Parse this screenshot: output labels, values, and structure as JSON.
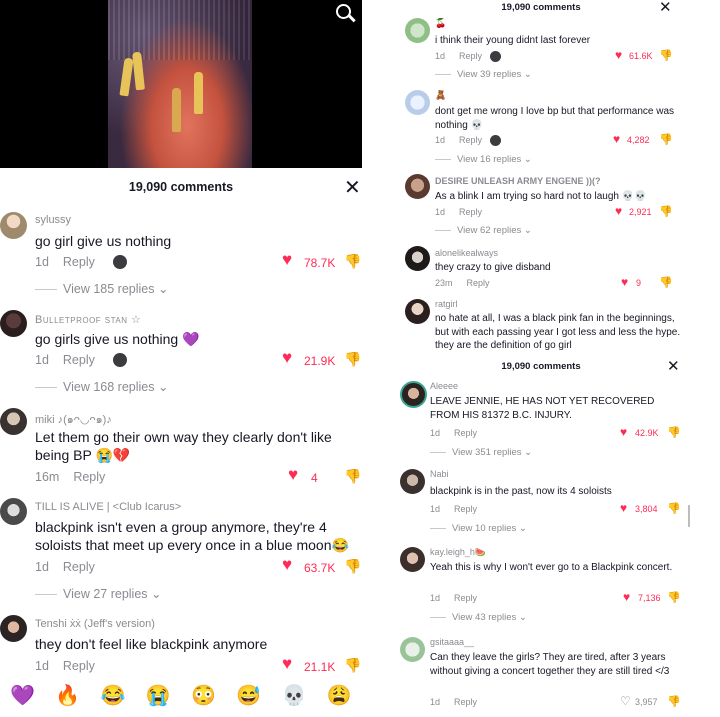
{
  "left": {
    "header": {
      "count": "19,090 comments"
    },
    "comments": [
      {
        "user": "sylussy",
        "text": "go girl give us nothing",
        "age": "1d",
        "reply": "Reply",
        "likes": "78.7K",
        "liked": true,
        "view": "View 185 replies"
      },
      {
        "user": "Bulletproof stan ☆",
        "text": "go girls give us nothing 💜",
        "age": "1d",
        "reply": "Reply",
        "likes": "21.9K",
        "liked": true,
        "view": "View 168 replies"
      },
      {
        "user": "miki ♪(๑ᴖ◡ᴖ๑)♪",
        "text": "Let them go their own way they clearly don't like being BP 😭💔",
        "age": "16m",
        "reply": "Reply",
        "likes": "4",
        "liked": true
      },
      {
        "user": "TILL IS ALIVE  | <Club Icarus>",
        "text": "blackpink isn't even a group anymore, they're 4 soloists that meet up every once in a blue moon😂",
        "age": "1d",
        "reply": "Reply",
        "likes": "63.7K",
        "liked": true,
        "view": "View 27 replies"
      },
      {
        "user": "Tenshi ẋẋ (Jeff's version)",
        "text": "they don't feel like blackpink anymore",
        "age": "1d",
        "reply": "Reply",
        "likes": "21.1K",
        "liked": true
      }
    ],
    "emojis": [
      "💜",
      "🔥",
      "😂",
      "😭",
      "😳",
      "😅",
      "💀",
      "😩"
    ]
  },
  "right_top": {
    "header": {
      "count": "19,090 comments"
    },
    "comments": [
      {
        "user": "🍒",
        "text": "i think their young didnt last forever",
        "age": "1d",
        "reply": "Reply",
        "likes": "61.6K",
        "liked": true,
        "view": "View 39 replies"
      },
      {
        "user": "🧸",
        "text": "dont get me wrong I love bp but that performance was nothing 💀",
        "age": "1d",
        "reply": "Reply",
        "likes": "4,282",
        "liked": true,
        "view": "View 16 replies"
      },
      {
        "user": "DESIRE UNLEASH ARMY ENGENE ))(?",
        "text": "As a blink I am trying so hard not to laugh 💀💀",
        "age": "1d",
        "reply": "Reply",
        "likes": "2,921",
        "liked": true,
        "view": "View 62 replies"
      },
      {
        "user": "alonelikealways",
        "text": "they crazy to give disband",
        "age": "23m",
        "reply": "Reply",
        "likes": "9",
        "liked": true
      },
      {
        "user": "ratgirl",
        "text": "no hate at all, I was a black pink fan in the beginnings, but with each passing year I got less and less the hype. they are the definition of go girl"
      }
    ]
  },
  "right_bottom": {
    "header": {
      "count": "19,090 comments"
    },
    "comments": [
      {
        "user": "Aleeee",
        "text": "LEAVE JENNIE, HE HAS NOT YET RECOVERED FROM HIS 81372 B.C. INJURY.",
        "age": "1d",
        "reply": "Reply",
        "likes": "42.9K",
        "liked": true,
        "view": "View 351 replies"
      },
      {
        "user": "Nabi",
        "text": "blackpink is in the past, now its 4 soloists",
        "age": "1d",
        "reply": "Reply",
        "likes": "3,804",
        "liked": true,
        "view": "View 10 replies"
      },
      {
        "user": "kay.leigh_h🍉",
        "text": "Yeah this is why I won't ever go to a Blackpink concert.",
        "age": "1d",
        "reply": "Reply",
        "likes": "7,136",
        "liked": true,
        "view": "View 43 replies"
      },
      {
        "user": "gsitaaaa__",
        "text": "Can they leave the girls? They are tired, after 3 years without giving a concert together they are still tired </3",
        "age": "1d",
        "reply": "Reply",
        "likes": "3,957",
        "liked": false
      }
    ]
  },
  "colors": {
    "like": "#fe2c55",
    "muted": "#8a8b91",
    "text": "#161823"
  }
}
